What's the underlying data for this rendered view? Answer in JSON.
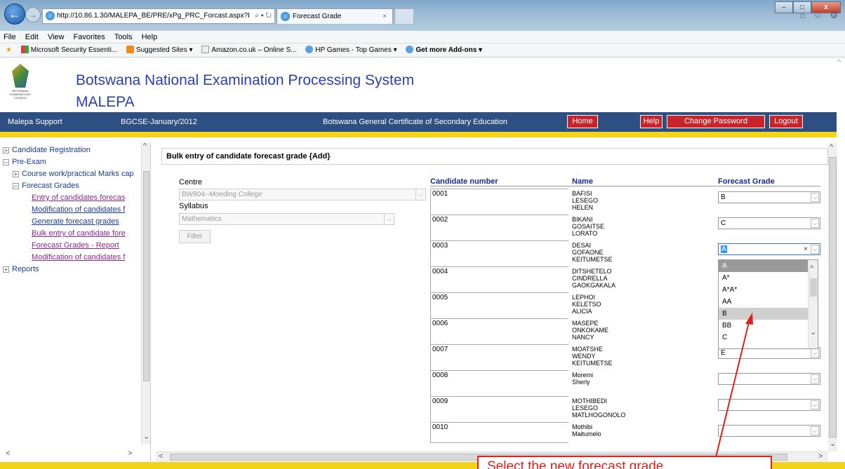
{
  "browser": {
    "url": "http://10.86.1.30/MALEPA_BE/PRE/xPg_PRC_Forcast.aspx?I",
    "addr_tools": "⌕ ▾ ↻",
    "tab_title": "Forecast Grade",
    "tab_close": "×",
    "win_min": "–",
    "win_max": "□",
    "win_close": "x",
    "right_icons": "⌂ ☆ ⚙",
    "back": "←",
    "forward": "→"
  },
  "menubar": [
    "File",
    "Edit",
    "View",
    "Favorites",
    "Tools",
    "Help"
  ],
  "favorites": {
    "item1": "Microsoft Security Essenti...",
    "item2": "Suggested Sites ▾",
    "item3": "Amazon.co.uk – Online S...",
    "item4": "HP Games - Top Games ▾",
    "item5": "Get more Add-ons ▾"
  },
  "header": {
    "logo_text": "BOTSWANA EXAMINATIONS COUNCIL",
    "title": "Botswana National Examination Processing System",
    "subtitle": "MALEPA"
  },
  "bluebar": {
    "support": "Malepa Support",
    "session": "BGCSE-January/2012",
    "program": "Botswana General Certificate of Secondary Education",
    "home": "Home",
    "help": "Help",
    "change_password": "Change Password",
    "logout": "Logout"
  },
  "tree": {
    "candidate_registration": "Candidate Registration",
    "pre_exam": "Pre-Exam",
    "coursework": "Course work/practical Marks cap",
    "forecast_grades": "Forecast Grades",
    "entry": "Entry of candidates forecas",
    "modification1": "Modification of candidates f",
    "generate": "Generate forecast grades",
    "bulk": "Bulk entry of candidate fore",
    "report": "Forecast Grades - Report",
    "modification2": "Modification of candidates f",
    "reports": "Reports"
  },
  "main": {
    "heading": "Bulk entry of candidate forecast grade {Add}",
    "centre_label": "Centre",
    "centre_value": "BW804--Moeding College",
    "syllabus_label": "Syllabus",
    "syllabus_value": "Mathematics",
    "filter_label": "Filter"
  },
  "grid": {
    "col_candidate": "Candidate number",
    "col_name": "Name",
    "col_grade": "Forecast Grade",
    "rows": [
      {
        "number": "0001",
        "name": [
          "BAFISI",
          "LESEGO",
          "HELEN"
        ],
        "grade": "B"
      },
      {
        "number": "0002",
        "name": [
          "BIKANI",
          "GOSAITSE",
          "LORATO"
        ],
        "grade": "C"
      },
      {
        "number": "0003",
        "name": [
          "DESAI",
          "GOFAONE",
          "KEITUMETSE"
        ],
        "grade": "A"
      },
      {
        "number": "0004",
        "name": [
          "DITSHETELO",
          "CINDRELLA",
          "GAOKGAKALA"
        ],
        "grade": ""
      },
      {
        "number": "0005",
        "name": [
          "LEPHOI",
          "KELETSO",
          "ALICIA"
        ],
        "grade": ""
      },
      {
        "number": "0006",
        "name": [
          "MASEPE",
          "ONKOKAME",
          "NANCY"
        ],
        "grade": ""
      },
      {
        "number": "0007",
        "name": [
          "MOATSHE",
          "WENDY",
          "KEITUMETSE"
        ],
        "grade": "E"
      },
      {
        "number": "0008",
        "name": [
          "Moremi",
          "Sherly",
          ""
        ],
        "grade": ""
      },
      {
        "number": "0009",
        "name": [
          "MOTHIBEDI",
          "LESEGO",
          "MATLHOGONOLO"
        ],
        "grade": ""
      },
      {
        "number": "0010",
        "name": [
          "Mothibi",
          "Maitumelo",
          ""
        ],
        "grade": ""
      }
    ]
  },
  "dropdown": {
    "options": [
      "A",
      "A*",
      "A*A*",
      "AA",
      "B",
      "BB",
      "C"
    ],
    "selected": "A",
    "hovered": "B"
  },
  "callout": "Select the new forecast grade",
  "colors": {
    "brand_blue": "#2e4f82",
    "accent_yellow": "#f2d51a",
    "button_red": "#c8242b",
    "title_blue": "#2c3fb0",
    "annotation_red": "#e0201b"
  }
}
